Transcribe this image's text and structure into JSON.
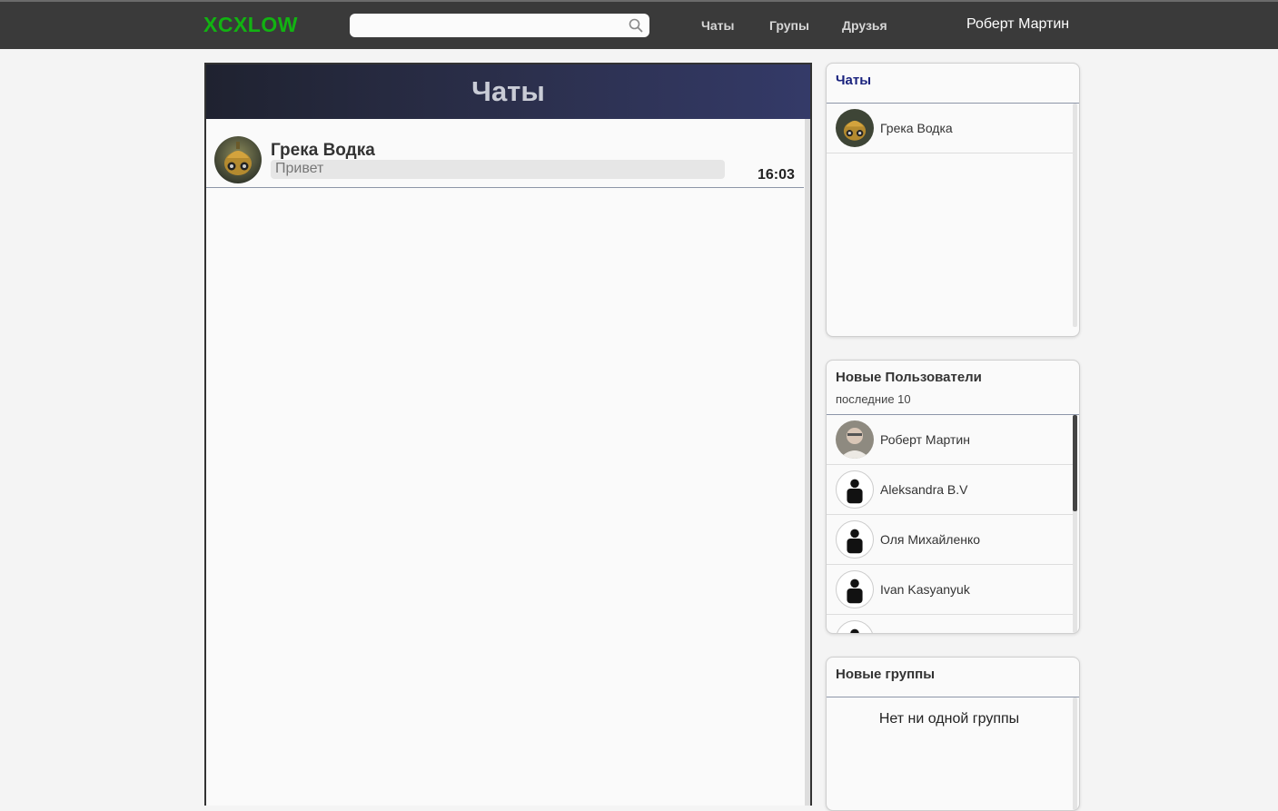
{
  "app": {
    "logo": "XCXLOW"
  },
  "search": {
    "placeholder": ""
  },
  "nav": {
    "chats": "Чаты",
    "groups": "Групы",
    "friends": "Друзья",
    "user": "Роберт Мартин"
  },
  "chat_panel": {
    "title": "Чаты",
    "rows": [
      {
        "name": "Грека Водка",
        "message": "Привет",
        "time": "16:03"
      }
    ]
  },
  "side_chats": {
    "title": "Чаты",
    "items": [
      {
        "name": "Грека Водка"
      }
    ]
  },
  "new_users": {
    "title": "Новые Пользователи",
    "subtitle": "последние 10",
    "items": [
      {
        "name": "Роберт Мартин"
      },
      {
        "name": "Aleksandra B.V"
      },
      {
        "name": "Оля Михайленко"
      },
      {
        "name": "Ivan Kasyanyuk"
      }
    ]
  },
  "new_groups": {
    "title": "Новые группы",
    "empty": "Нет ни одной группы"
  },
  "colors": {
    "logo": "#12b312",
    "nav_bg": "#3a3a3a",
    "header_grad_end": "#343a68",
    "side_title_blue": "#1a237e"
  }
}
